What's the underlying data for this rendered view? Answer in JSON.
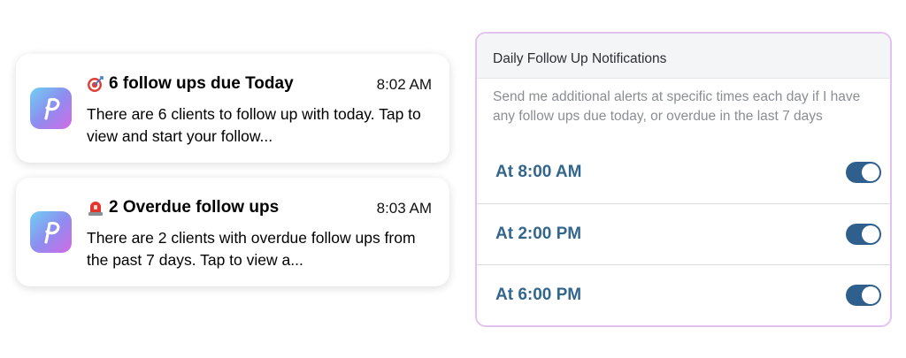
{
  "notifications": [
    {
      "icon": "p-logo-icon",
      "emoji": "target-emoji-icon",
      "title": "6 follow ups due Today",
      "time": "8:02 AM",
      "body": "There are 6 clients to follow up with today. Tap to view and start your follow..."
    },
    {
      "icon": "p-logo-icon",
      "emoji": "siren-emoji-icon",
      "title": "2 Overdue follow ups",
      "time": "8:03 AM",
      "body": "There are 2 clients with overdue follow ups from the past 7 days. Tap to view a..."
    }
  ],
  "settings": {
    "title": "Daily Follow Up Notifications",
    "description": "Send me additional alerts at specific times each day if I have any follow ups due today, or overdue in the last 7 days",
    "toggle_color": "#2f5f8c",
    "label_color": "#33668d",
    "items": [
      {
        "label": "At 8:00 AM",
        "enabled": true
      },
      {
        "label": "At 2:00 PM",
        "enabled": true
      },
      {
        "label": "At 6:00 PM",
        "enabled": true
      }
    ]
  }
}
